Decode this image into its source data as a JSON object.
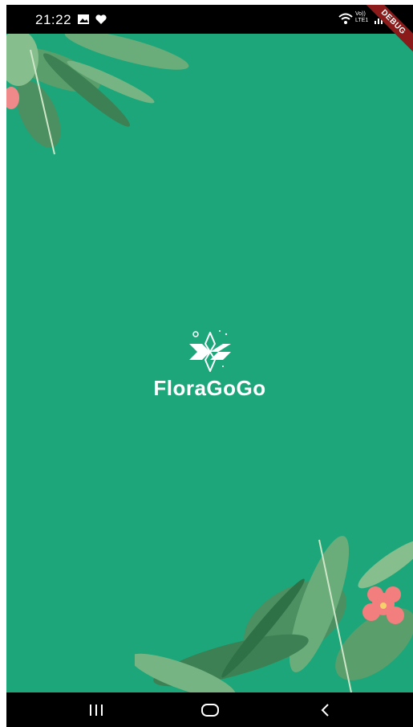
{
  "status_bar": {
    "time": "21:22",
    "left_icons": [
      "image-icon",
      "heart-icon"
    ],
    "right_icons": [
      "wifi-icon",
      "volte-icon",
      "signal-icon"
    ],
    "volte_label": "Vo)) LTE1"
  },
  "debug_banner": "DEBUG",
  "splash": {
    "brand_name": "FloraGoGo",
    "logo_icon": "flower-logo-icon",
    "background_color": "#1ca67a"
  },
  "nav_bar": {
    "buttons": [
      "recents-icon",
      "home-icon",
      "back-icon"
    ]
  }
}
